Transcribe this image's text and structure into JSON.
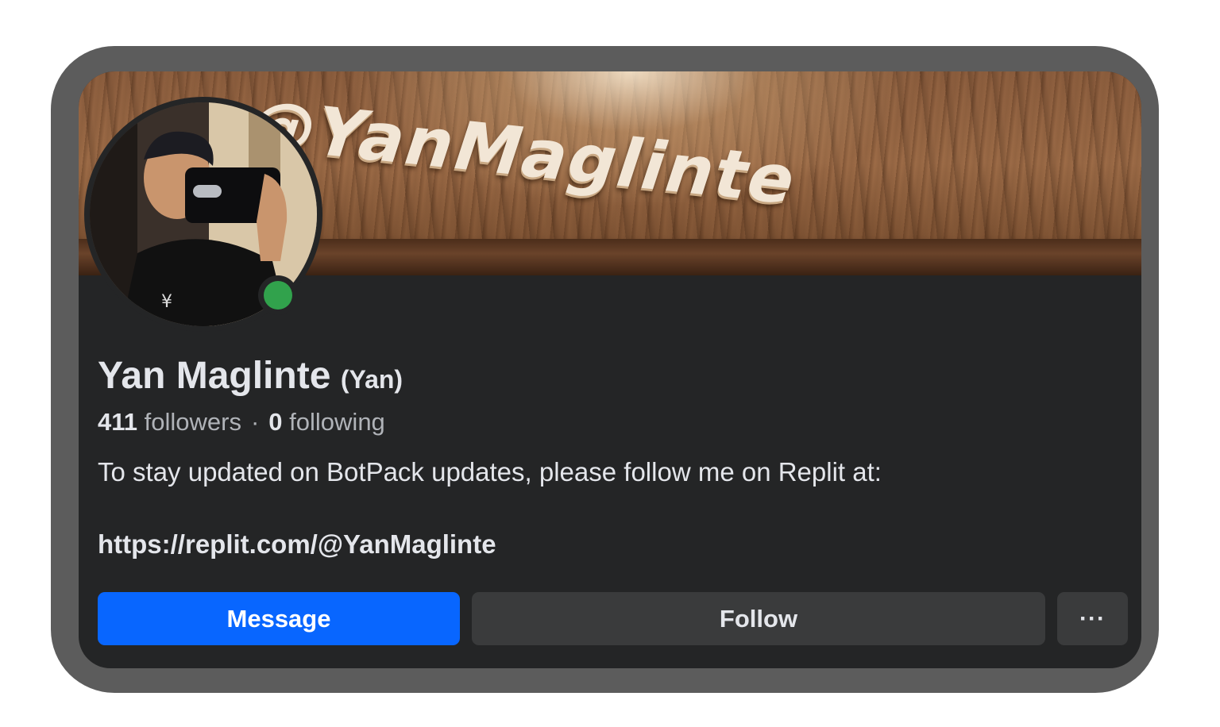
{
  "cover": {
    "text": "@YanMaglinte"
  },
  "profile": {
    "name": "Yan Maglinte",
    "nickname": "(Yan)",
    "followers_count": "411",
    "followers_label": "followers",
    "separator": "·",
    "following_count": "0",
    "following_label": "following",
    "online": true,
    "online_color": "#31a24c"
  },
  "bio": {
    "text": "To stay updated on BotPack updates, please follow me on Replit at:",
    "link": "https://replit.com/@YanMaglinte"
  },
  "actions": {
    "message_label": "Message",
    "follow_label": "Follow",
    "more_label": "···",
    "message_color": "#0866ff"
  },
  "icons": {
    "more": "more-options-icon",
    "online": "online-status-icon"
  }
}
